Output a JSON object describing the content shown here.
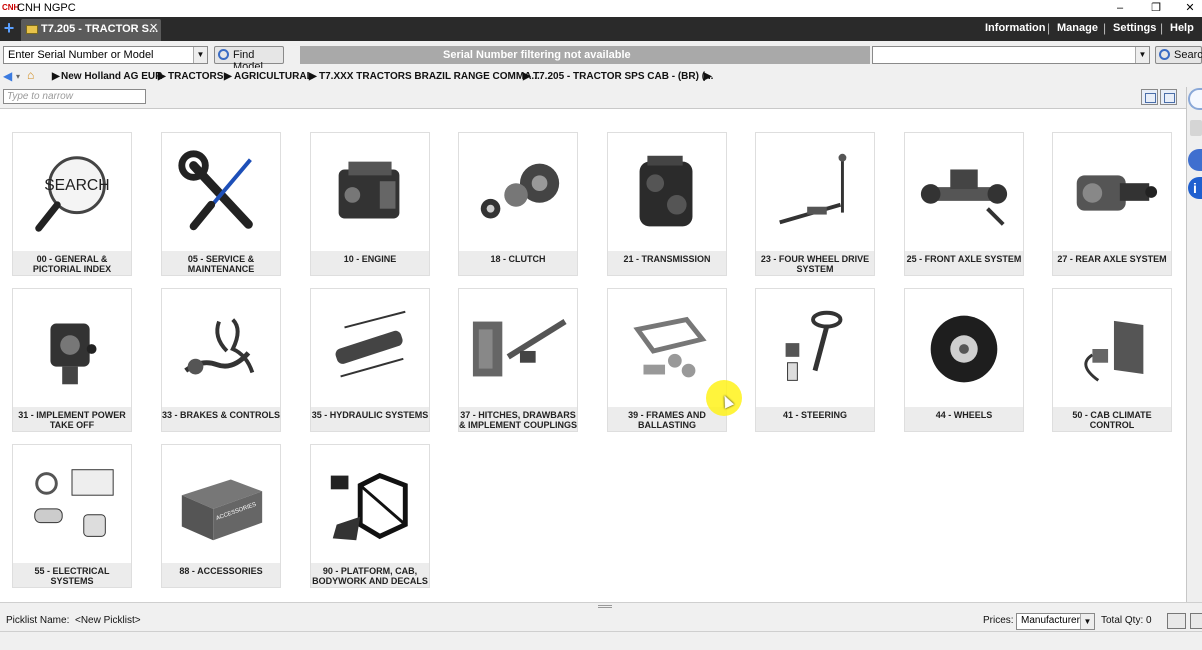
{
  "window": {
    "title": "CNH NGPC",
    "minimize": "–",
    "restore": "❐",
    "close": "✕"
  },
  "tab": {
    "label": "T7.205 - TRACTOR S...",
    "close": "✕"
  },
  "top_menu": [
    "Information",
    "Manage",
    "Settings",
    "Help"
  ],
  "search_row": {
    "serial_placeholder": "Enter Serial Number or Model",
    "find_model": "Find Model",
    "serial_status": "Serial Number filtering not available",
    "search_value": "",
    "search_button": "Search"
  },
  "breadcrumb": [
    "New Holland AG EUR",
    "TRACTORS",
    "AGRICULTURAL",
    "T7.XXX TRACTORS BRAZIL RANGE COMMA...",
    "T7.205 - TRACTOR SPS CAB - (BR) (..."
  ],
  "filter": {
    "placeholder": "Type to narrow"
  },
  "categories": [
    {
      "label": "00 - GENERAL & PICTORIAL INDEX",
      "icon": "search-magnifier-icon",
      "search_word": "SEARCH"
    },
    {
      "label": "05 - SERVICE & MAINTENANCE",
      "icon": "wrench-screwdriver-icon"
    },
    {
      "label": "10 - ENGINE",
      "icon": "engine-icon"
    },
    {
      "label": "18 - CLUTCH",
      "icon": "clutch-icon"
    },
    {
      "label": "21 - TRANSMISSION",
      "icon": "transmission-icon"
    },
    {
      "label": "23 - FOUR WHEEL DRIVE SYSTEM",
      "icon": "drive-shaft-icon"
    },
    {
      "label": "25 - FRONT AXLE SYSTEM",
      "icon": "front-axle-icon"
    },
    {
      "label": "27 - REAR AXLE SYSTEM",
      "icon": "rear-axle-icon"
    },
    {
      "label": "31 - IMPLEMENT POWER TAKE OFF",
      "icon": "pto-icon"
    },
    {
      "label": "33 - BRAKES & CONTROLS",
      "icon": "brakes-icon"
    },
    {
      "label": "35 - HYDRAULIC SYSTEMS",
      "icon": "hydraulic-cylinder-icon"
    },
    {
      "label": "37 - HITCHES, DRAWBARS & IMPLEMENT COUPLINGS",
      "icon": "hitch-icon"
    },
    {
      "label": "39 - FRAMES AND BALLASTING",
      "icon": "frame-icon"
    },
    {
      "label": "41 - STEERING",
      "icon": "steering-icon"
    },
    {
      "label": "44 - WHEELS",
      "icon": "wheel-icon"
    },
    {
      "label": "50 - CAB CLIMATE CONTROL",
      "icon": "radiator-icon"
    },
    {
      "label": "55 - ELECTRICAL SYSTEMS",
      "icon": "electrical-icon"
    },
    {
      "label": "88 - ACCESSORIES",
      "icon": "accessories-crate-icon",
      "crate_text": "ACCESSORIES"
    },
    {
      "label": "90 - PLATFORM, CAB, BODYWORK AND DECALS",
      "icon": "cab-frame-icon"
    }
  ],
  "bottom_bar": {
    "picklist_label": "Picklist Name:",
    "picklist_value": "<New Picklist>",
    "prices_label": "Prices:",
    "prices_value": "Manufacturer",
    "total_qty": "Total Qty: 0"
  }
}
